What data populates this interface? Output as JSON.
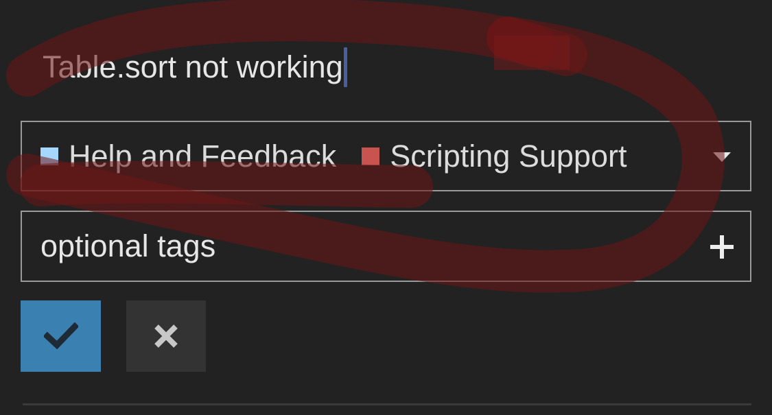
{
  "topic": {
    "title_value": "Table.sort not working"
  },
  "categories": [
    {
      "label": "Help and Feedback",
      "color": "#a6d8ff"
    },
    {
      "label": "Scripting Support",
      "color": "#c9534e"
    }
  ],
  "tags": {
    "placeholder": "optional tags"
  },
  "actions": {
    "confirm_icon": "checkmark-icon",
    "cancel_icon": "close-icon"
  },
  "colors": {
    "accent": "#3a80b0",
    "annotation": "#7a1a1a"
  }
}
